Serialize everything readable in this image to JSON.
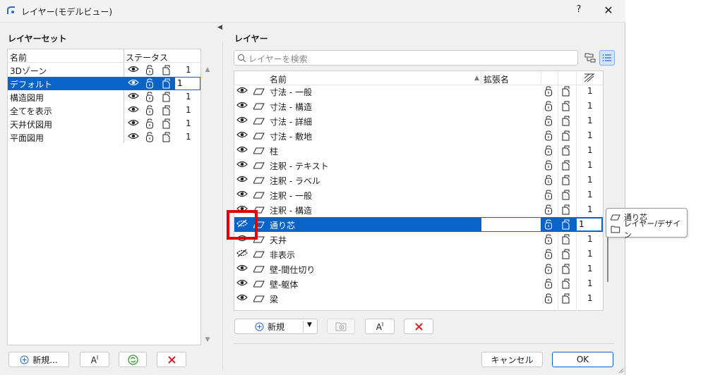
{
  "window": {
    "title": "レイヤー(モデルビュー)",
    "help": "?",
    "close": "✕"
  },
  "left": {
    "section_title": "レイヤーセット",
    "columns": {
      "name": "名前",
      "status": "ステータス"
    },
    "rows": [
      {
        "name": "3Dゾーン",
        "num": "1"
      },
      {
        "name": "デフォルト",
        "num": "1"
      },
      {
        "name": "構造図用",
        "num": "1"
      },
      {
        "name": "全てを表示",
        "num": "1"
      },
      {
        "name": "天井伏図用",
        "num": "1"
      },
      {
        "name": "平面図用",
        "num": "1"
      }
    ],
    "selected_index": 1,
    "buttons": {
      "new": "新規..."
    }
  },
  "right": {
    "section_title": "レイヤー",
    "search_placeholder": "レイヤーを検索",
    "columns": {
      "name": "名前",
      "ext": "拡張名"
    },
    "rows": [
      {
        "name": "寸法 - 一般",
        "num": "1",
        "visible": true
      },
      {
        "name": "寸法 - 構造",
        "num": "1",
        "visible": true
      },
      {
        "name": "寸法 - 詳細",
        "num": "1",
        "visible": true
      },
      {
        "name": "寸法 - 敷地",
        "num": "1",
        "visible": true
      },
      {
        "name": "柱",
        "num": "1",
        "visible": true
      },
      {
        "name": "注釈 - テキスト",
        "num": "1",
        "visible": true
      },
      {
        "name": "注釈 - ラベル",
        "num": "1",
        "visible": true
      },
      {
        "name": "注釈 - 一般",
        "num": "1",
        "visible": true
      },
      {
        "name": "注釈 - 構造",
        "num": "1",
        "visible": true
      },
      {
        "name": "通り芯",
        "num": "1",
        "visible": false
      },
      {
        "name": "天井",
        "num": "1",
        "visible": true
      },
      {
        "name": "非表示",
        "num": "1",
        "visible": false
      },
      {
        "name": "壁-間仕切り",
        "num": "1",
        "visible": true
      },
      {
        "name": "壁-躯体",
        "num": "1",
        "visible": true
      },
      {
        "name": "梁",
        "num": "1",
        "visible": true
      }
    ],
    "selected_index": 9,
    "buttons": {
      "new": "新規"
    }
  },
  "footer": {
    "cancel": "キャンセル",
    "ok": "OK"
  },
  "tooltip": {
    "layer": "通り芯",
    "folder": "レイヤー/デザイン"
  },
  "colors": {
    "selection": "#0a64c8",
    "highlight": "#e00000",
    "delete": "#e02020",
    "refresh": "#2a9a2a"
  }
}
